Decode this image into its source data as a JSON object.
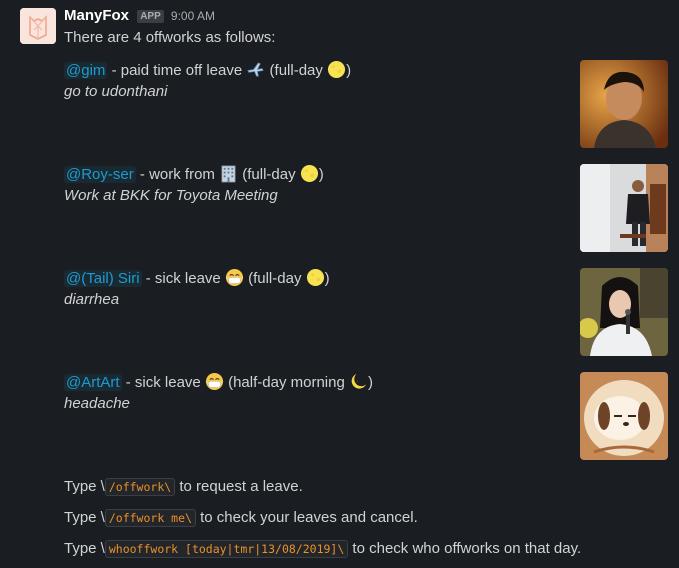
{
  "message": {
    "sender": "ManyFox",
    "badge": "APP",
    "time": "9:00 AM",
    "intro": "There are 4 offworks as follows:"
  },
  "entries": [
    {
      "mention": "@gim",
      "text_before": " - paid time off leave ",
      "text_after": " (full-day ",
      "close": ")",
      "note": "go to udonthani",
      "icon": "airplane-icon",
      "period_icon": "full-moon-icon"
    },
    {
      "mention": "@Roy-ser",
      "text_before": " -  work from ",
      "text_after": " (full-day ",
      "close": ")",
      "note": "Work at BKK for Toyota Meeting",
      "icon": "office-building-icon",
      "period_icon": "full-moon-icon"
    },
    {
      "mention": "@(Tail) Siri",
      "text_before": " - sick leave ",
      "text_after": " (full-day ",
      "close": ")",
      "note": "diarrhea",
      "icon": "mask-face-icon",
      "period_icon": "full-moon-icon"
    },
    {
      "mention": "@ArtArt",
      "text_before": " - sick leave ",
      "text_after": " (half-day morning ",
      "close": ")",
      "note": "headache",
      "icon": "mask-face-icon",
      "period_icon": "crescent-moon-icon"
    }
  ],
  "footer": [
    {
      "prefix": "Type \\",
      "code": "/offwork\\",
      "suffix": " to request a leave."
    },
    {
      "prefix": "Type \\",
      "code": "/offwork me\\",
      "suffix": " to check your leaves and cancel."
    },
    {
      "prefix": "Type \\",
      "code": "whooffwork [today|tmr|13/08/2019]\\",
      "suffix": " to check who offworks on that day."
    }
  ]
}
